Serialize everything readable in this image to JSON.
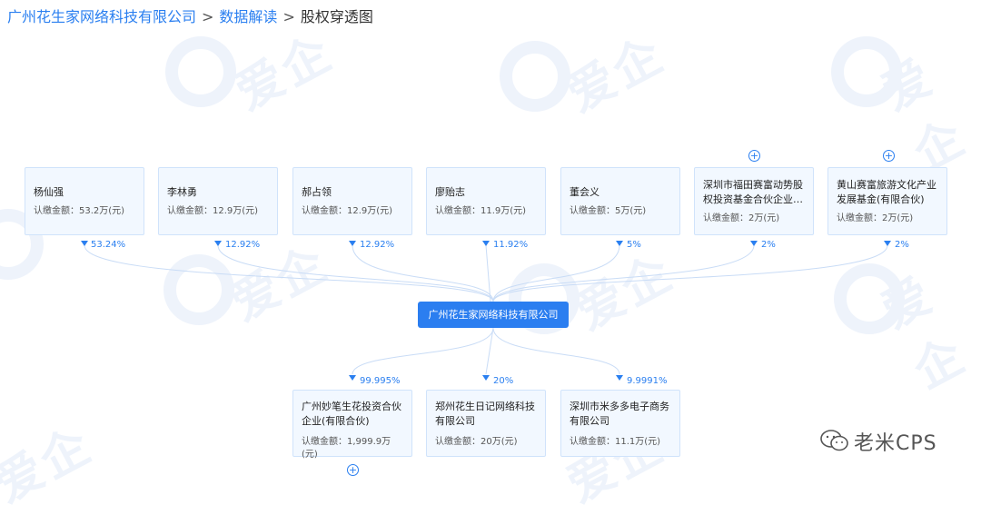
{
  "breadcrumb": {
    "items": [
      "广州花生家网络科技有限公司",
      "数据解读",
      "股权穿透图"
    ],
    "separator": ">"
  },
  "watermark": {
    "text": "爱企查"
  },
  "center": {
    "name": "广州花生家网络科技有限公司"
  },
  "amount_label": "认缴金额：",
  "shareholders": [
    {
      "name": "杨仙强",
      "amount": "53.2万(元)",
      "percent": "53.24%"
    },
    {
      "name": "李林勇",
      "amount": "12.9万(元)",
      "percent": "12.92%"
    },
    {
      "name": "郝占领",
      "amount": "12.9万(元)",
      "percent": "12.92%"
    },
    {
      "name": "廖贻志",
      "amount": "11.9万(元)",
      "percent": "11.92%"
    },
    {
      "name": "董会义",
      "amount": "5万(元)",
      "percent": "5%"
    },
    {
      "name": "深圳市福田赛富动势股权投资基金合伙企业(有限合伙)",
      "amount": "2万(元)",
      "percent": "2%",
      "expandable": true
    },
    {
      "name": "黄山赛富旅游文化产业发展基金(有限合伙)",
      "amount": "2万(元)",
      "percent": "2%",
      "expandable": true
    }
  ],
  "investments": [
    {
      "name": "广州妙笔生花投资合伙企业(有限合伙)",
      "amount": "1,999.9万(元)",
      "percent": "99.995%",
      "expandable": true
    },
    {
      "name": "郑州花生日记网络科技有限公司",
      "amount": "20万(元)",
      "percent": "20%"
    },
    {
      "name": "深圳市米多多电子商务有限公司",
      "amount": "11.1万(元)",
      "percent": "9.9991%"
    }
  ],
  "expand_symbol": "+",
  "footer": {
    "brand": "老米CPS",
    "icon": "wechat-icon"
  },
  "colors": {
    "accent": "#2b7ef0",
    "card_bg": "#f2f8ff",
    "card_border": "#d0e3fb",
    "link": "#2a7ff0"
  }
}
